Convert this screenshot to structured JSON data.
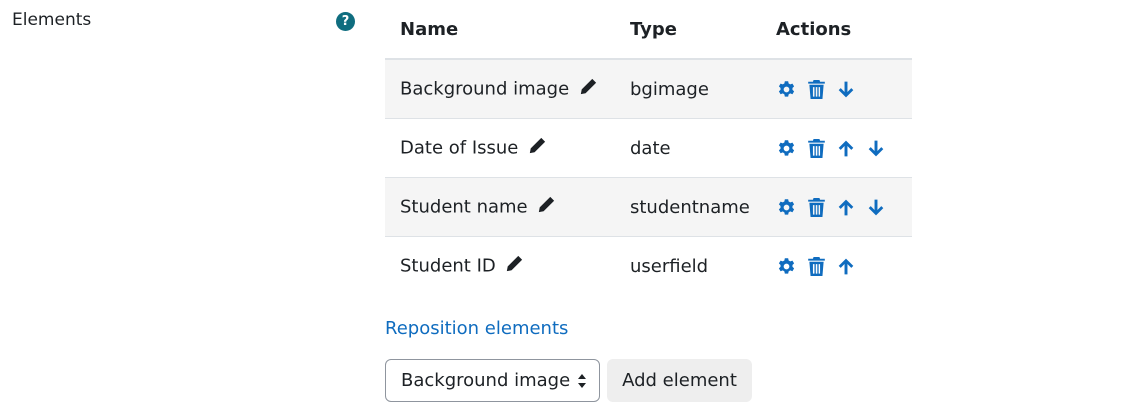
{
  "section": {
    "label": "Elements",
    "help_icon": "question-circle-icon"
  },
  "table": {
    "headers": {
      "name": "Name",
      "type": "Type",
      "actions": "Actions"
    },
    "rows": [
      {
        "name": "Background image",
        "type": "bgimage"
      },
      {
        "name": "Date of Issue",
        "type": "date"
      },
      {
        "name": "Student name",
        "type": "studentname"
      },
      {
        "name": "Student ID",
        "type": "userfield"
      }
    ],
    "icons": {
      "edit": "pencil-icon",
      "settings": "gear-icon",
      "delete": "trash-icon",
      "move_up": "arrow-up-icon",
      "move_down": "arrow-down-icon"
    }
  },
  "reposition_link": "Reposition elements",
  "add_form": {
    "selected_element": "Background image",
    "add_button_label": "Add element"
  },
  "colors": {
    "action_icon": "#0f6cbf",
    "link": "#0f6cbf",
    "help_icon": "#0f6d7f",
    "row_stripe": "#f5f5f5"
  }
}
